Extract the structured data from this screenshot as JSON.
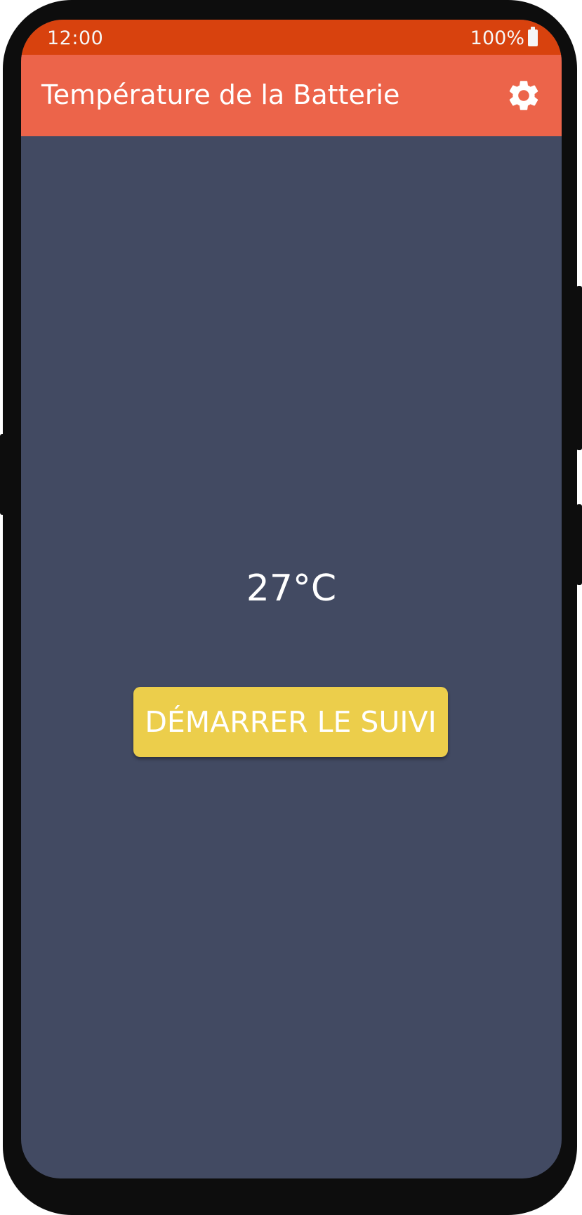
{
  "status_bar": {
    "time": "12:00",
    "battery_percent": "100%",
    "battery_icon": "battery-full-icon",
    "background_color": "#d8420e"
  },
  "app_bar": {
    "title": "Température de la Batterie",
    "settings_icon": "gear-icon",
    "background_color": "#ec644a"
  },
  "main": {
    "temperature": "27°C",
    "start_button_label": "DÉMARRER LE SUIVI",
    "background_color": "#424a62",
    "button_color": "#ecce4b"
  }
}
